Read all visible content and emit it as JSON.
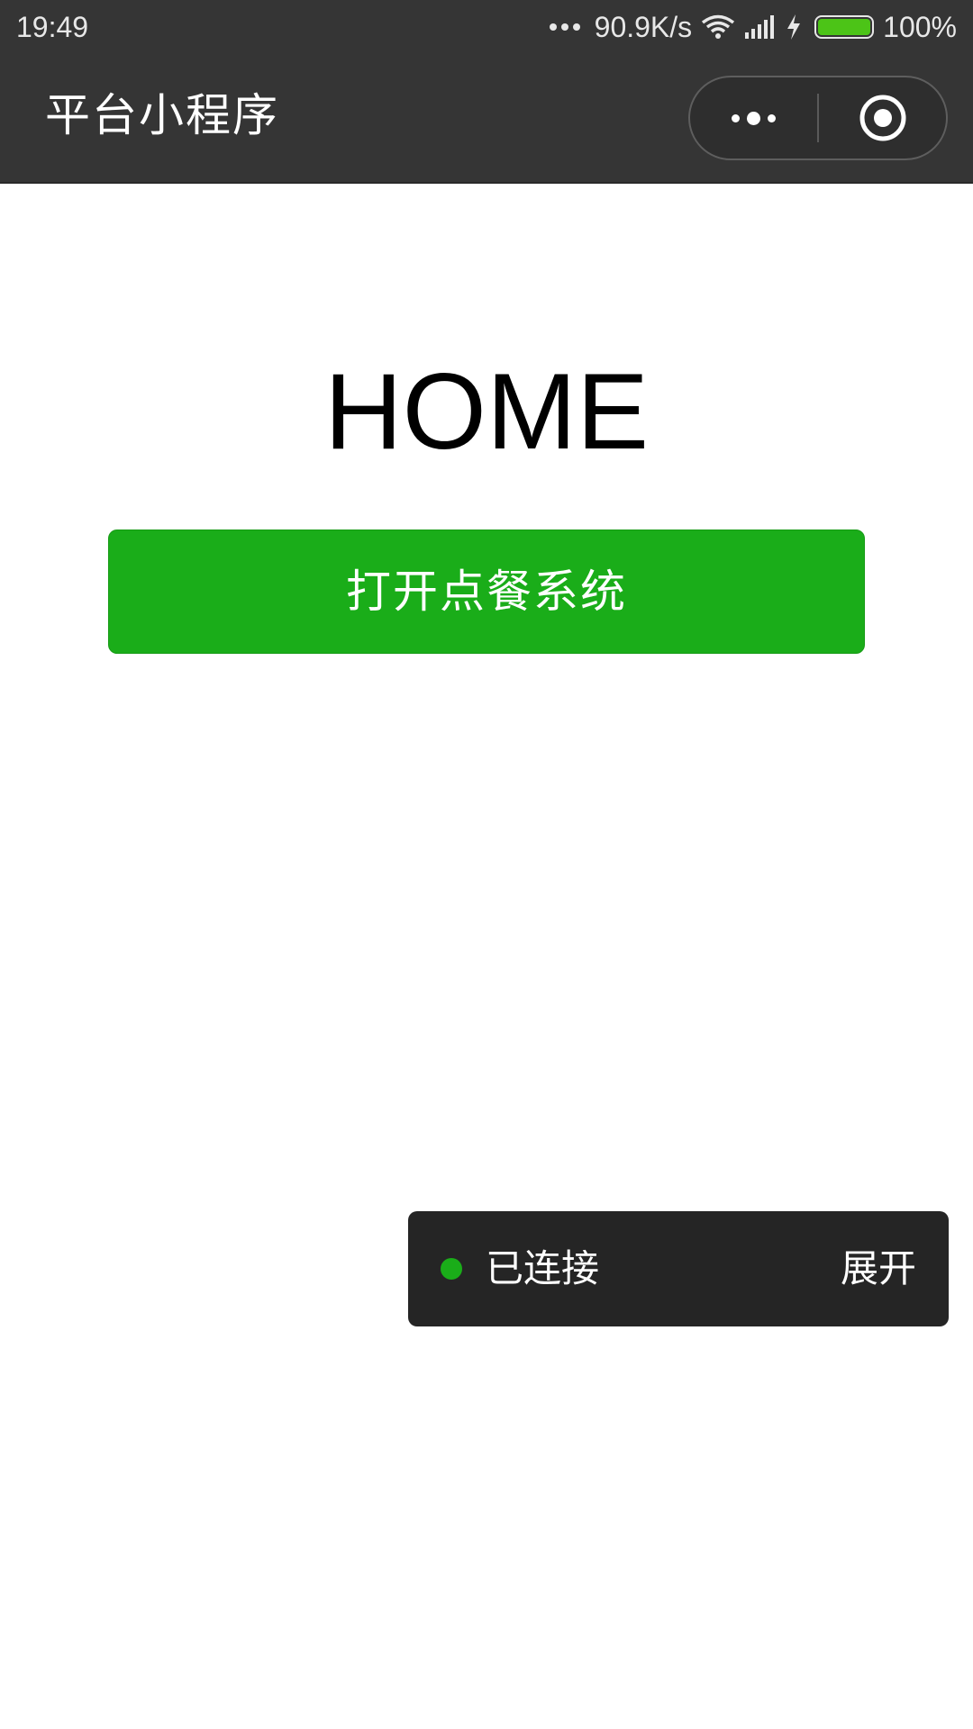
{
  "status_bar": {
    "time": "19:49",
    "network_speed": "90.9K/s",
    "battery_percent": "100%",
    "battery_level": 1.0,
    "icons": [
      "more-dots-icon",
      "wifi-icon",
      "signal-icon",
      "charging-icon",
      "battery-icon"
    ]
  },
  "nav": {
    "title": "平台小程序",
    "menu_icon": "more-icon",
    "close_icon": "target-close-icon"
  },
  "main": {
    "title": "HOME",
    "open_button_label": "打开点餐系统"
  },
  "debug_panel": {
    "status": "已连接",
    "expand_label": "展开"
  },
  "colors": {
    "nav_background": "#353535",
    "primary_green": "#1aad19",
    "panel_background": "#252525",
    "battery_green": "#4cc417"
  }
}
